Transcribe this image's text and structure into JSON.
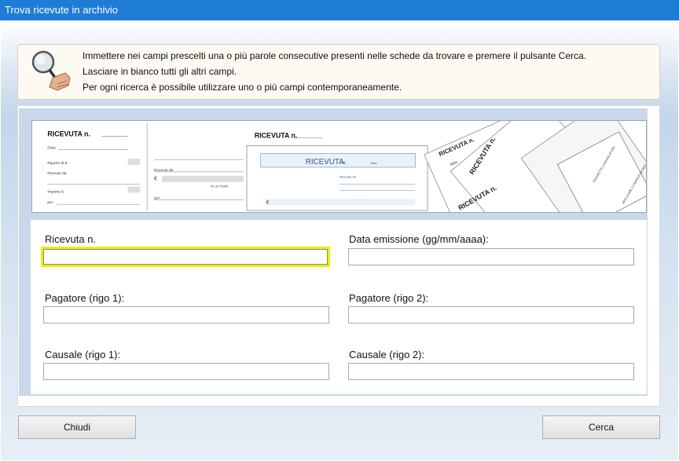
{
  "window": {
    "title": "Trova ricevute in archivio"
  },
  "info": {
    "lines": [
      "Immettere nei campi prescelti una o più parole consecutive presenti nelle schede da trovare e premere il pulsante Cerca.",
      "Lasciare in bianco tutti gli altri campi.",
      "Per ogni ricerca è possibile utilizzare uno o più campi contemporaneamente."
    ]
  },
  "banner": {
    "r1_title": "RICEVUTA n.",
    "r1_rows": [
      "Data",
      "Riporto di €",
      "Ricevuti da",
      "Importo €",
      "per"
    ],
    "r2_rows": [
      "Ricevuti da",
      "€",
      "IN LETTERE",
      "per"
    ],
    "r3_title": "RICEVUTA n.",
    "r3_inner_title": "RICEVUTA",
    "r3_inner_n": "N.",
    "r3_inner_data": "Data",
    "r3_ricevuto": "Ricevuto da",
    "r3_euro": "€",
    "r4_texts": [
      "RICEVUTA n.",
      "RICEVUTA n.",
      "data",
      "RICEVUTA n.",
      "SOGGETTA a imposta di bollo",
      "APPLICARE LA MARCA DA BOLLO"
    ]
  },
  "form": {
    "fields": [
      {
        "label": "Ricevuta n.",
        "value": ""
      },
      {
        "label": "Data emissione (gg/mm/aaaa):",
        "value": ""
      },
      {
        "label": "Pagatore (rigo 1):",
        "value": ""
      },
      {
        "label": "Pagatore (rigo 2):",
        "value": ""
      },
      {
        "label": "Causale (rigo 1):",
        "value": ""
      },
      {
        "label": "Causale (rigo 2):",
        "value": ""
      }
    ]
  },
  "buttons": {
    "close": "Chiudi",
    "search": "Cerca"
  },
  "colors": {
    "titlebar": "#1f7cd6",
    "focus": "#eeee00"
  }
}
